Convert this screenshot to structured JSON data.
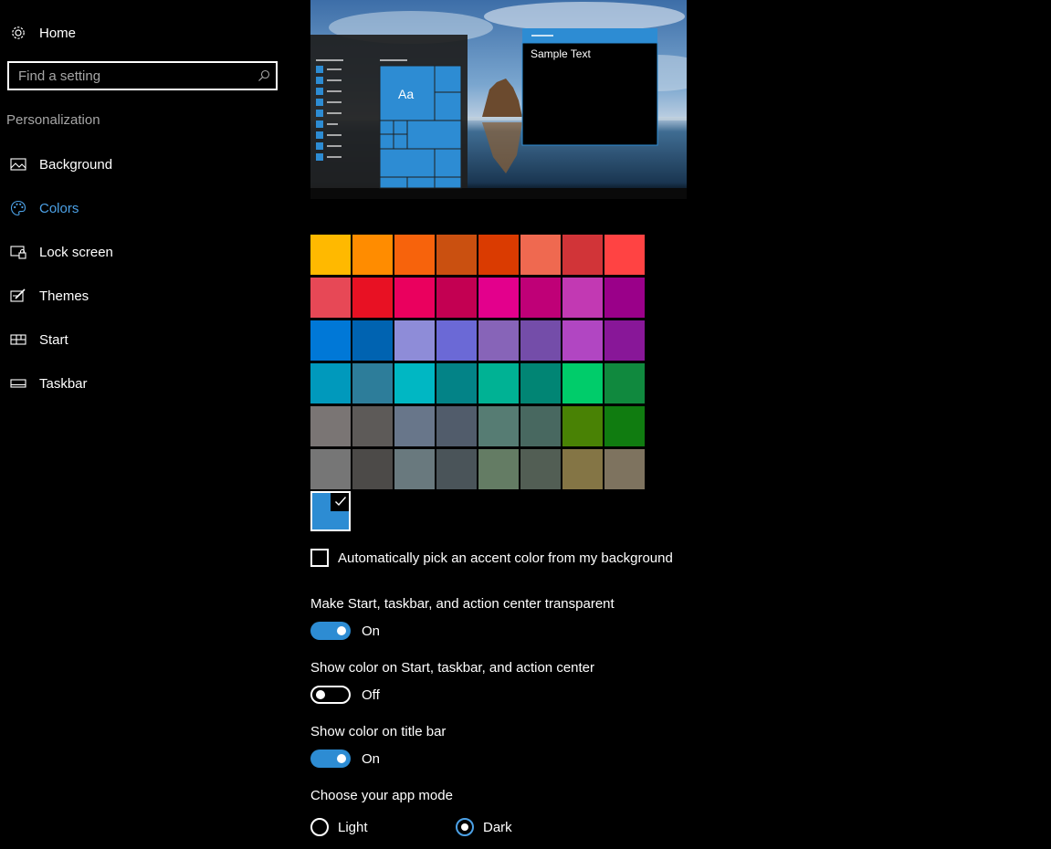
{
  "sidebar": {
    "home_label": "Home",
    "search_placeholder": "Find a setting",
    "section_title": "Personalization",
    "items": [
      {
        "label": "Background",
        "icon": "picture-icon"
      },
      {
        "label": "Colors",
        "icon": "palette-icon",
        "active": true
      },
      {
        "label": "Lock screen",
        "icon": "lock-screen-icon"
      },
      {
        "label": "Themes",
        "icon": "themes-icon"
      },
      {
        "label": "Start",
        "icon": "start-icon"
      },
      {
        "label": "Taskbar",
        "icon": "taskbar-icon"
      }
    ]
  },
  "preview": {
    "sample_text": "Sample Text",
    "tile_text": "Aa"
  },
  "colors": {
    "accent": "#2d8cd3",
    "swatch_rows": [
      [
        "#ffb900",
        "#ff8c00",
        "#f7630c",
        "#ca5010",
        "#da3b01",
        "#ef6950",
        "#d13438",
        "#ff4343"
      ],
      [
        "#e74856",
        "#e81123",
        "#ea005e",
        "#c30052",
        "#e3008c",
        "#bf0077",
        "#c239b3",
        "#9a0089"
      ],
      [
        "#0078d7",
        "#0063b1",
        "#8e8cd8",
        "#6b69d6",
        "#8764b8",
        "#744da9",
        "#b146c2",
        "#881798"
      ],
      [
        "#0099bc",
        "#2d7d9a",
        "#00b7c3",
        "#038387",
        "#00b294",
        "#018574",
        "#00cc6a",
        "#10893e"
      ],
      [
        "#7a7574",
        "#5d5a58",
        "#68768a",
        "#515c6b",
        "#567c73",
        "#486860",
        "#498205",
        "#107c10"
      ],
      [
        "#767676",
        "#4c4a48",
        "#69797e",
        "#4a5459",
        "#647c64",
        "#525e54",
        "#847545",
        "#7e735f"
      ]
    ],
    "custom_swatch": "#2d8cd3"
  },
  "options": {
    "auto_pick_label": "Automatically pick an accent color from my background",
    "auto_pick_checked": false,
    "transparent_label": "Make Start, taskbar, and action center transparent",
    "transparent_state": "On",
    "show_start_label": "Show color on Start, taskbar, and action center",
    "show_start_state": "Off",
    "title_bar_label": "Show color on title bar",
    "title_bar_state": "On",
    "app_mode_label": "Choose your app mode",
    "mode_light": "Light",
    "mode_dark": "Dark",
    "selected_mode": "Dark"
  }
}
